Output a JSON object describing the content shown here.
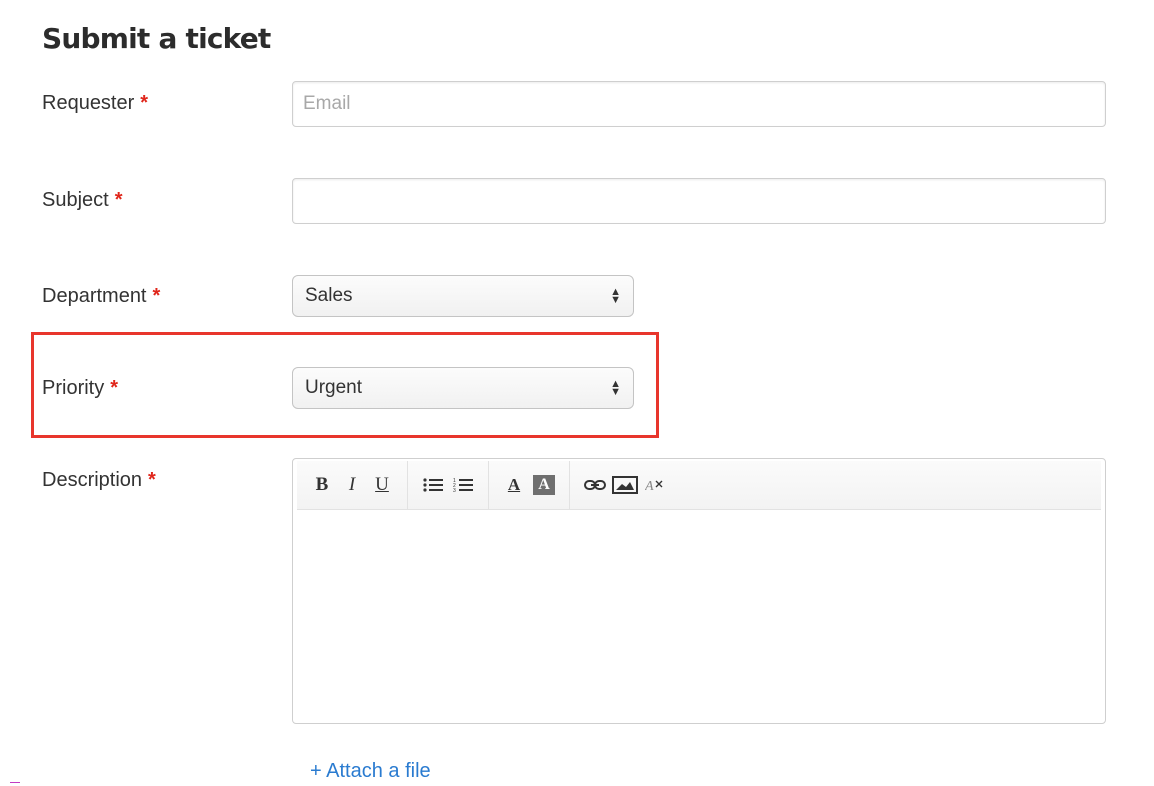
{
  "page_title": "Submit a ticket",
  "required_mark": "*",
  "fields": {
    "requester": {
      "label": "Requester",
      "placeholder": "Email",
      "value": ""
    },
    "subject": {
      "label": "Subject",
      "value": ""
    },
    "department": {
      "label": "Department",
      "selected": "Sales"
    },
    "priority": {
      "label": "Priority",
      "selected": "Urgent"
    },
    "description": {
      "label": "Description",
      "value": ""
    }
  },
  "toolbar": {
    "bold": "B",
    "italic": "I",
    "underline": "U",
    "font_color": "A",
    "highlight_color": "A"
  },
  "attach_link": "+ Attach a file",
  "colors": {
    "required": "#e0261b",
    "highlight_border": "#e8352c",
    "link": "#2a7bd0"
  },
  "icons": [
    "bullet-list-icon",
    "numbered-list-icon",
    "link-icon",
    "image-icon",
    "clear-format-icon",
    "updown-arrows-icon"
  ]
}
